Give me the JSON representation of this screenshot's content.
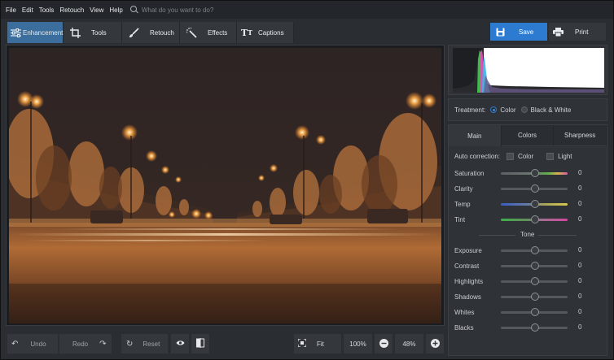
{
  "menu": [
    "File",
    "Edit",
    "Tools",
    "Retouch",
    "View",
    "Help"
  ],
  "search": {
    "placeholder": "What do you want to do?"
  },
  "tabs": {
    "enhancement": "Enhancement",
    "tools": "Tools",
    "retouch": "Retouch",
    "effects": "Effects",
    "captions": "Captions"
  },
  "actions": {
    "save": "Save",
    "print": "Print"
  },
  "bottom": {
    "undo": "Undo",
    "redo": "Redo",
    "reset": "Reset",
    "fit": "Fit",
    "zoom_100": "100%",
    "zoom_current": "48%"
  },
  "treatment": {
    "label": "Treatment:",
    "color": "Color",
    "bw": "Black & White",
    "selected": "Color"
  },
  "panel_tabs": {
    "main": "Main",
    "colors": "Colors",
    "sharpness": "Sharpness",
    "active": "Main"
  },
  "auto_correction": {
    "label": "Auto correction:",
    "color": "Color",
    "light": "Light"
  },
  "tone_label": "Tone",
  "sliders_top": [
    {
      "label": "Saturation",
      "value": "0",
      "gradient": "saturation"
    },
    {
      "label": "Clarity",
      "value": "0",
      "gradient": "plain"
    },
    {
      "label": "Temp",
      "value": "0",
      "gradient": "temp"
    },
    {
      "label": "Tint",
      "value": "0",
      "gradient": "tint"
    }
  ],
  "sliders_tone": [
    {
      "label": "Exposure",
      "value": "0"
    },
    {
      "label": "Contrast",
      "value": "0"
    },
    {
      "label": "Highlights",
      "value": "0"
    },
    {
      "label": "Shadows",
      "value": "0"
    },
    {
      "label": "Whites",
      "value": "0"
    },
    {
      "label": "Blacks",
      "value": "0"
    }
  ],
  "colors": {
    "accent": "#2d7bd0",
    "active_tab": "#3b6e9c",
    "panel": "#2f3237",
    "background": "#2a2d31"
  }
}
